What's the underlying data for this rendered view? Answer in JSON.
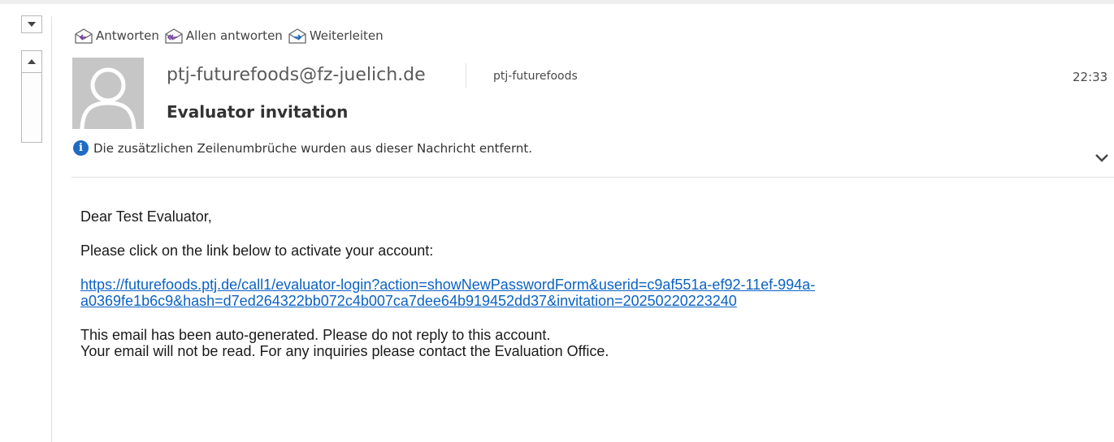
{
  "toolbar": {
    "reply_label": "Antworten",
    "reply_all_label": "Allen antworten",
    "forward_label": "Weiterleiten"
  },
  "header": {
    "sender_email": "ptj-futurefoods@fz-juelich.de",
    "sender_name": "ptj-futurefoods",
    "time": "22:33",
    "subject": "Evaluator invitation",
    "info_text": "Die zusätzlichen Zeilenumbrüche wurden aus dieser Nachricht entfernt."
  },
  "body": {
    "greeting": "Dear Test Evaluator,",
    "instruction": "Please click on the link below to activate your account:",
    "link_line1": "https://futurefoods.ptj.de/call1/evaluator-login?action=showNewPasswordForm&userid=c9af551a-ef92-11ef-994a-",
    "link_line2": "a0369fe1b6c9&hash=d7ed264322bb072c4b007ca7dee64b919452dd37&invitation=20250220223240",
    "footer_line1": "This email has been auto-generated. Please do not reply to this account.",
    "footer_line2": "Your email will not be read. For any inquiries please contact the Evaluation Office."
  },
  "icons": {
    "reply": "reply-icon",
    "reply_all": "reply-all-icon",
    "forward": "forward-icon",
    "info": "info-icon",
    "expand": "chevron-down-icon"
  },
  "colors": {
    "link": "#0b62c4",
    "info_icon": "#1f6bc2",
    "reply_arrow": "#7a3fa6",
    "forward_arrow": "#1f6bc2"
  }
}
